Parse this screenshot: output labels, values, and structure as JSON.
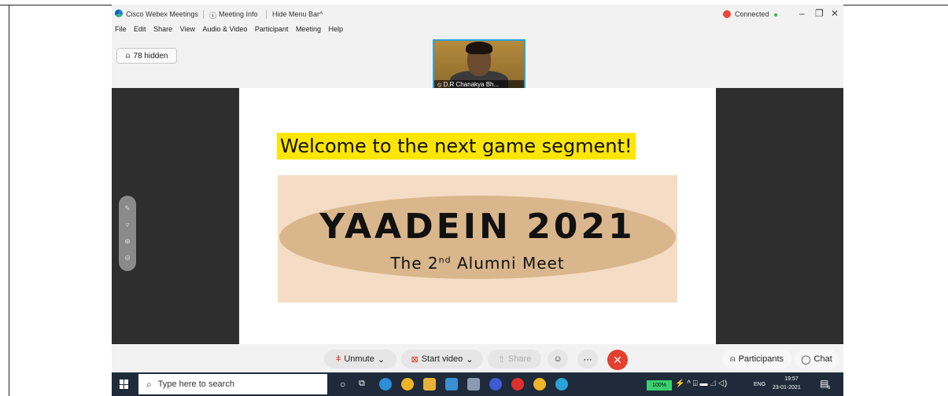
{
  "titlebar": {
    "app_name": "Cisco Webex Meetings",
    "meeting_info": "Meeting Info",
    "hide_menu": "Hide Menu Bar",
    "connection_status": "Connected",
    "minimize": "–",
    "restore": "❐",
    "close": "✕"
  },
  "menubar": {
    "items": [
      "File",
      "Edit",
      "Share",
      "View",
      "Audio & Video",
      "Participant",
      "Meeting",
      "Help"
    ]
  },
  "hidden_participants": "78 hidden",
  "video_tile": {
    "name": "D.R Chanakya Bh..."
  },
  "slide": {
    "heading": "Welcome to the next game segment!",
    "banner_title": "YAADEIN 2021",
    "banner_subtitle_pre": "The 2",
    "banner_subtitle_sup": "nd",
    "banner_subtitle_post": " Alumni Meet"
  },
  "controls": {
    "unmute": "Unmute",
    "start_video": "Start video",
    "share": "Share",
    "participants": "Participants",
    "chat": "Chat"
  },
  "taskbar": {
    "search_placeholder": "Type here to search",
    "battery": "100%",
    "language": "ENG",
    "time": "19:57",
    "date": "23-01-2021",
    "notifications": "6"
  },
  "colors": {
    "accent_blue": "#2ba3d8",
    "end_red": "#e3402f",
    "slide_highlight": "#ffe600",
    "taskbar": "#1f2b3a"
  }
}
